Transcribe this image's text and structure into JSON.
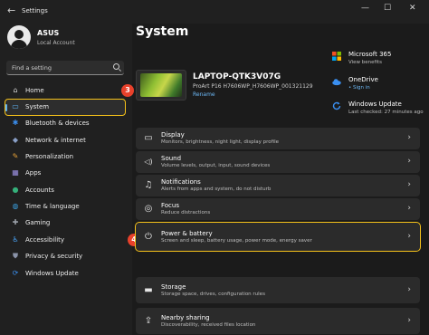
{
  "titlebar": {
    "back_icon": "←",
    "title": "Settings",
    "minimize": "—",
    "maximize": "☐",
    "close": "✕"
  },
  "profile": {
    "name": "ASUS",
    "account": "Local Account"
  },
  "search": {
    "placeholder": "Find a setting"
  },
  "sidebar": {
    "items": [
      {
        "label": "Home",
        "icon": "home-icon",
        "glyph": "⌂",
        "color": "#d9d9d9"
      },
      {
        "label": "System",
        "icon": "monitor-icon",
        "glyph": "▭",
        "color": "#5fb2f2"
      },
      {
        "label": "Bluetooth & devices",
        "icon": "bluetooth-icon",
        "glyph": "✱",
        "color": "#3a8ff0"
      },
      {
        "label": "Network & internet",
        "icon": "wifi-icon",
        "glyph": "◆",
        "color": "#8aa0c8"
      },
      {
        "label": "Personalization",
        "icon": "brush-icon",
        "glyph": "✎",
        "color": "#e6a23a"
      },
      {
        "label": "Apps",
        "icon": "apps-icon",
        "glyph": "▦",
        "color": "#9b8fe0"
      },
      {
        "label": "Accounts",
        "icon": "accounts-icon",
        "glyph": "●",
        "color": "#35b07a"
      },
      {
        "label": "Time & language",
        "icon": "globe-icon",
        "glyph": "◍",
        "color": "#3aa0e0"
      },
      {
        "label": "Gaming",
        "icon": "gamepad-icon",
        "glyph": "✚",
        "color": "#9aa0a8"
      },
      {
        "label": "Accessibility",
        "icon": "accessibility-icon",
        "glyph": "♿",
        "color": "#4aa8ff"
      },
      {
        "label": "Privacy & security",
        "icon": "shield-icon",
        "glyph": "⛊",
        "color": "#8a93a8"
      },
      {
        "label": "Windows Update",
        "icon": "update-icon",
        "glyph": "⟳",
        "color": "#3a8ff0"
      }
    ]
  },
  "steps": {
    "first": "3",
    "second": "4"
  },
  "main": {
    "title": "System",
    "device": {
      "name": "LAPTOP-QTK3V07G",
      "model": "ProArt P16 H7606WP_H7606WP_001321129",
      "rename": "Rename"
    },
    "info": [
      {
        "title": "Microsoft 365",
        "subtitle": "View benefits",
        "icon": "microsoft-365-icon"
      },
      {
        "title": "OneDrive",
        "subtitle": "• Sign in",
        "icon": "onedrive-icon"
      },
      {
        "title": "Windows Update",
        "subtitle": "Last checked: 27 minutes ago",
        "icon": "windows-update-icon"
      }
    ],
    "cards": [
      {
        "title": "Display",
        "subtitle": "Monitors, brightness, night light, display profile",
        "icon": "display-icon",
        "glyph": "▭"
      },
      {
        "title": "Sound",
        "subtitle": "Volume levels, output, input, sound devices",
        "icon": "speaker-icon",
        "glyph": "◁)"
      },
      {
        "title": "Notifications",
        "subtitle": "Alerts from apps and system, do not disturb",
        "icon": "bell-icon",
        "glyph": "♫"
      },
      {
        "title": "Focus",
        "subtitle": "Reduce distractions",
        "icon": "focus-icon",
        "glyph": "◎"
      },
      {
        "title": "Power & battery",
        "subtitle": "Screen and sleep, battery usage, power mode, energy saver",
        "icon": "power-icon",
        "glyph": "⏻"
      },
      {
        "title": "Storage",
        "subtitle": "Storage space, drives, configuration rules",
        "icon": "storage-icon",
        "glyph": "▬"
      },
      {
        "title": "Nearby sharing",
        "subtitle": "Discoverability, received files location",
        "icon": "share-icon",
        "glyph": "⇪"
      }
    ]
  },
  "colors": {
    "accent": "#5fb2f2",
    "highlight": "#f6c21a",
    "step_badge": "#e8412b"
  }
}
